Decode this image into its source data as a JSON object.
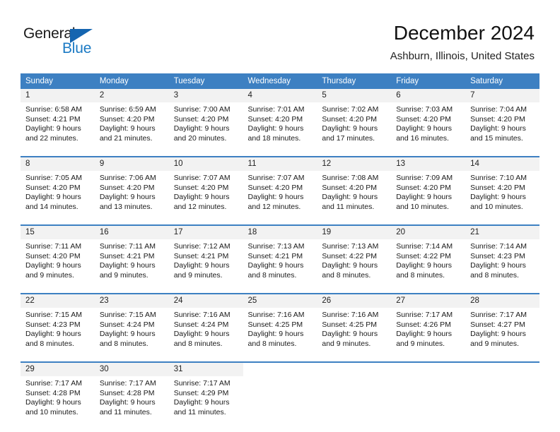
{
  "brand": {
    "name_top": "General",
    "name_bottom": "Blue",
    "triangle_color": "#1565b0",
    "blue_color": "#1b7ac4"
  },
  "header": {
    "title": "December 2024",
    "subtitle": "Ashburn, Illinois, United States"
  },
  "theme": {
    "header_row_bg": "#3d80c2",
    "daynum_bg": "#f2f2f2",
    "separator": "#3d80c2"
  },
  "weekdays": [
    "Sunday",
    "Monday",
    "Tuesday",
    "Wednesday",
    "Thursday",
    "Friday",
    "Saturday"
  ],
  "weeks": [
    [
      {
        "day": "1",
        "sunrise": "Sunrise: 6:58 AM",
        "sunset": "Sunset: 4:21 PM",
        "daylight1": "Daylight: 9 hours",
        "daylight2": "and 22 minutes."
      },
      {
        "day": "2",
        "sunrise": "Sunrise: 6:59 AM",
        "sunset": "Sunset: 4:20 PM",
        "daylight1": "Daylight: 9 hours",
        "daylight2": "and 21 minutes."
      },
      {
        "day": "3",
        "sunrise": "Sunrise: 7:00 AM",
        "sunset": "Sunset: 4:20 PM",
        "daylight1": "Daylight: 9 hours",
        "daylight2": "and 20 minutes."
      },
      {
        "day": "4",
        "sunrise": "Sunrise: 7:01 AM",
        "sunset": "Sunset: 4:20 PM",
        "daylight1": "Daylight: 9 hours",
        "daylight2": "and 18 minutes."
      },
      {
        "day": "5",
        "sunrise": "Sunrise: 7:02 AM",
        "sunset": "Sunset: 4:20 PM",
        "daylight1": "Daylight: 9 hours",
        "daylight2": "and 17 minutes."
      },
      {
        "day": "6",
        "sunrise": "Sunrise: 7:03 AM",
        "sunset": "Sunset: 4:20 PM",
        "daylight1": "Daylight: 9 hours",
        "daylight2": "and 16 minutes."
      },
      {
        "day": "7",
        "sunrise": "Sunrise: 7:04 AM",
        "sunset": "Sunset: 4:20 PM",
        "daylight1": "Daylight: 9 hours",
        "daylight2": "and 15 minutes."
      }
    ],
    [
      {
        "day": "8",
        "sunrise": "Sunrise: 7:05 AM",
        "sunset": "Sunset: 4:20 PM",
        "daylight1": "Daylight: 9 hours",
        "daylight2": "and 14 minutes."
      },
      {
        "day": "9",
        "sunrise": "Sunrise: 7:06 AM",
        "sunset": "Sunset: 4:20 PM",
        "daylight1": "Daylight: 9 hours",
        "daylight2": "and 13 minutes."
      },
      {
        "day": "10",
        "sunrise": "Sunrise: 7:07 AM",
        "sunset": "Sunset: 4:20 PM",
        "daylight1": "Daylight: 9 hours",
        "daylight2": "and 12 minutes."
      },
      {
        "day": "11",
        "sunrise": "Sunrise: 7:07 AM",
        "sunset": "Sunset: 4:20 PM",
        "daylight1": "Daylight: 9 hours",
        "daylight2": "and 12 minutes."
      },
      {
        "day": "12",
        "sunrise": "Sunrise: 7:08 AM",
        "sunset": "Sunset: 4:20 PM",
        "daylight1": "Daylight: 9 hours",
        "daylight2": "and 11 minutes."
      },
      {
        "day": "13",
        "sunrise": "Sunrise: 7:09 AM",
        "sunset": "Sunset: 4:20 PM",
        "daylight1": "Daylight: 9 hours",
        "daylight2": "and 10 minutes."
      },
      {
        "day": "14",
        "sunrise": "Sunrise: 7:10 AM",
        "sunset": "Sunset: 4:20 PM",
        "daylight1": "Daylight: 9 hours",
        "daylight2": "and 10 minutes."
      }
    ],
    [
      {
        "day": "15",
        "sunrise": "Sunrise: 7:11 AM",
        "sunset": "Sunset: 4:20 PM",
        "daylight1": "Daylight: 9 hours",
        "daylight2": "and 9 minutes."
      },
      {
        "day": "16",
        "sunrise": "Sunrise: 7:11 AM",
        "sunset": "Sunset: 4:21 PM",
        "daylight1": "Daylight: 9 hours",
        "daylight2": "and 9 minutes."
      },
      {
        "day": "17",
        "sunrise": "Sunrise: 7:12 AM",
        "sunset": "Sunset: 4:21 PM",
        "daylight1": "Daylight: 9 hours",
        "daylight2": "and 9 minutes."
      },
      {
        "day": "18",
        "sunrise": "Sunrise: 7:13 AM",
        "sunset": "Sunset: 4:21 PM",
        "daylight1": "Daylight: 9 hours",
        "daylight2": "and 8 minutes."
      },
      {
        "day": "19",
        "sunrise": "Sunrise: 7:13 AM",
        "sunset": "Sunset: 4:22 PM",
        "daylight1": "Daylight: 9 hours",
        "daylight2": "and 8 minutes."
      },
      {
        "day": "20",
        "sunrise": "Sunrise: 7:14 AM",
        "sunset": "Sunset: 4:22 PM",
        "daylight1": "Daylight: 9 hours",
        "daylight2": "and 8 minutes."
      },
      {
        "day": "21",
        "sunrise": "Sunrise: 7:14 AM",
        "sunset": "Sunset: 4:23 PM",
        "daylight1": "Daylight: 9 hours",
        "daylight2": "and 8 minutes."
      }
    ],
    [
      {
        "day": "22",
        "sunrise": "Sunrise: 7:15 AM",
        "sunset": "Sunset: 4:23 PM",
        "daylight1": "Daylight: 9 hours",
        "daylight2": "and 8 minutes."
      },
      {
        "day": "23",
        "sunrise": "Sunrise: 7:15 AM",
        "sunset": "Sunset: 4:24 PM",
        "daylight1": "Daylight: 9 hours",
        "daylight2": "and 8 minutes."
      },
      {
        "day": "24",
        "sunrise": "Sunrise: 7:16 AM",
        "sunset": "Sunset: 4:24 PM",
        "daylight1": "Daylight: 9 hours",
        "daylight2": "and 8 minutes."
      },
      {
        "day": "25",
        "sunrise": "Sunrise: 7:16 AM",
        "sunset": "Sunset: 4:25 PM",
        "daylight1": "Daylight: 9 hours",
        "daylight2": "and 8 minutes."
      },
      {
        "day": "26",
        "sunrise": "Sunrise: 7:16 AM",
        "sunset": "Sunset: 4:25 PM",
        "daylight1": "Daylight: 9 hours",
        "daylight2": "and 9 minutes."
      },
      {
        "day": "27",
        "sunrise": "Sunrise: 7:17 AM",
        "sunset": "Sunset: 4:26 PM",
        "daylight1": "Daylight: 9 hours",
        "daylight2": "and 9 minutes."
      },
      {
        "day": "28",
        "sunrise": "Sunrise: 7:17 AM",
        "sunset": "Sunset: 4:27 PM",
        "daylight1": "Daylight: 9 hours",
        "daylight2": "and 9 minutes."
      }
    ],
    [
      {
        "day": "29",
        "sunrise": "Sunrise: 7:17 AM",
        "sunset": "Sunset: 4:28 PM",
        "daylight1": "Daylight: 9 hours",
        "daylight2": "and 10 minutes."
      },
      {
        "day": "30",
        "sunrise": "Sunrise: 7:17 AM",
        "sunset": "Sunset: 4:28 PM",
        "daylight1": "Daylight: 9 hours",
        "daylight2": "and 11 minutes."
      },
      {
        "day": "31",
        "sunrise": "Sunrise: 7:17 AM",
        "sunset": "Sunset: 4:29 PM",
        "daylight1": "Daylight: 9 hours",
        "daylight2": "and 11 minutes."
      },
      {
        "day": "",
        "sunrise": "",
        "sunset": "",
        "daylight1": "",
        "daylight2": ""
      },
      {
        "day": "",
        "sunrise": "",
        "sunset": "",
        "daylight1": "",
        "daylight2": ""
      },
      {
        "day": "",
        "sunrise": "",
        "sunset": "",
        "daylight1": "",
        "daylight2": ""
      },
      {
        "day": "",
        "sunrise": "",
        "sunset": "",
        "daylight1": "",
        "daylight2": ""
      }
    ]
  ]
}
